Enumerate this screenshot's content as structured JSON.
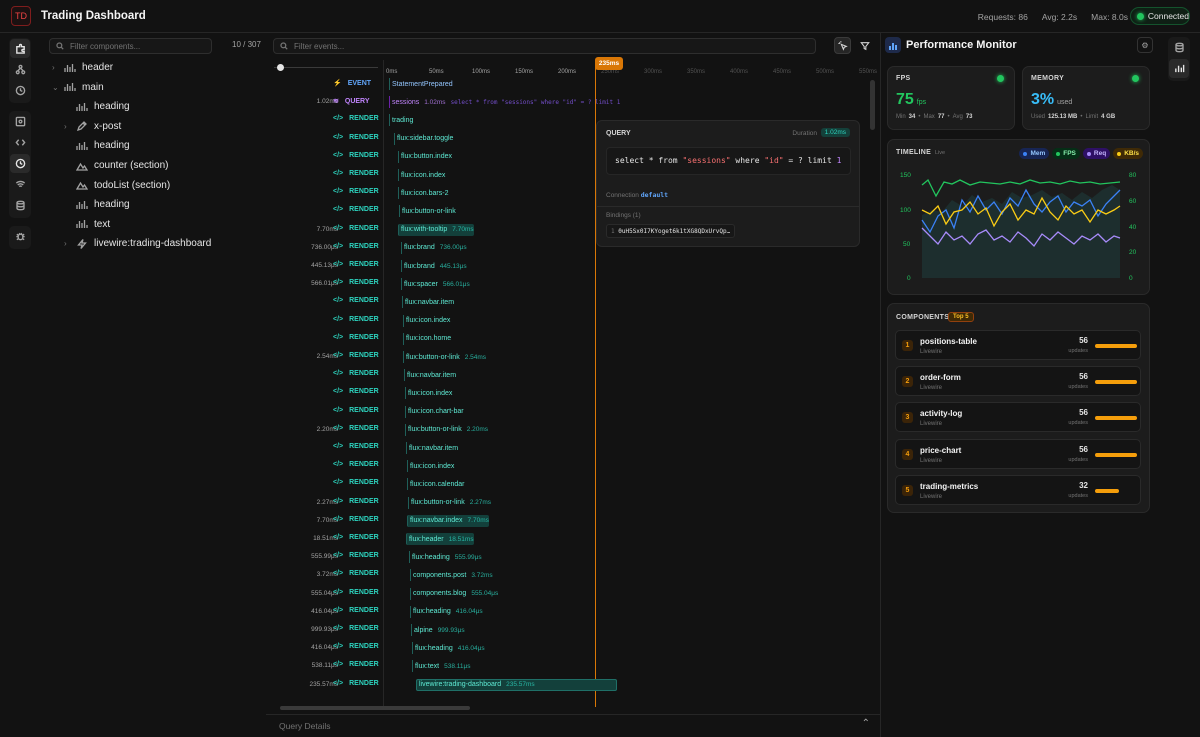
{
  "app": {
    "logo": "TD",
    "title": "Trading Dashboard"
  },
  "header_stats": {
    "requests": "Requests: 86",
    "avg": "Avg: 2.2s",
    "max": "Max: 8.0s",
    "connection": "Connected"
  },
  "tree": {
    "filter_placeholder": "Filter components...",
    "items": [
      {
        "label": "header",
        "icon": "bars-icon",
        "chev": "›"
      },
      {
        "label": "main",
        "icon": "bars-icon",
        "chev": "⌄"
      },
      {
        "label": "heading",
        "icon": "bars-icon",
        "chev": ""
      },
      {
        "label": "x-post",
        "icon": "pen-icon",
        "chev": "›"
      },
      {
        "label": "heading",
        "icon": "bars-icon",
        "chev": ""
      },
      {
        "label": "counter (section)",
        "icon": "mountain-icon",
        "chev": ""
      },
      {
        "label": "todoList (section)",
        "icon": "mountain-icon",
        "chev": ""
      },
      {
        "label": "heading",
        "icon": "bars-icon",
        "chev": ""
      },
      {
        "label": "text",
        "icon": "bars-icon",
        "chev": ""
      },
      {
        "label": "livewire:trading-dashboard",
        "icon": "bolt-icon",
        "chev": "›"
      }
    ]
  },
  "events": {
    "count": "10 / 307",
    "filter_placeholder": "Filter events...",
    "ticks": [
      "0ms",
      "50ms",
      "100ms",
      "150ms",
      "200ms",
      "250ms",
      "300ms",
      "350ms",
      "400ms",
      "450ms",
      "500ms",
      "550ms"
    ],
    "cursor_label": "235ms",
    "rows": [
      {
        "time": "",
        "kind": "EVENT",
        "label": "StatementPrepared",
        "dur": ""
      },
      {
        "time": "1.02ms",
        "kind": "QUERY",
        "label": "sessions",
        "dur": "1.02ms",
        "extra": "select * from \"sessions\" where \"id\" = ? limit 1"
      },
      {
        "time": "",
        "kind": "RENDER",
        "label": "trading",
        "dur": ""
      },
      {
        "time": "",
        "kind": "RENDER",
        "label": "flux:sidebar.toggle",
        "dur": ""
      },
      {
        "time": "",
        "kind": "RENDER",
        "label": "flux:button.index",
        "dur": ""
      },
      {
        "time": "",
        "kind": "RENDER",
        "label": "flux:icon.index",
        "dur": ""
      },
      {
        "time": "",
        "kind": "RENDER",
        "label": "flux:icon.bars-2",
        "dur": ""
      },
      {
        "time": "",
        "kind": "RENDER",
        "label": "flux:button-or-link",
        "dur": ""
      },
      {
        "time": "7.70ms",
        "kind": "RENDER",
        "label": "flux:with-tooltip",
        "dur": "7.70ms"
      },
      {
        "time": "736.00μs",
        "kind": "RENDER",
        "label": "flux:brand",
        "dur": "736.00μs"
      },
      {
        "time": "445.13μs",
        "kind": "RENDER",
        "label": "flux:brand",
        "dur": "445.13μs"
      },
      {
        "time": "566.01μs",
        "kind": "RENDER",
        "label": "flux:spacer",
        "dur": "566.01μs"
      },
      {
        "time": "",
        "kind": "RENDER",
        "label": "flux:navbar.item",
        "dur": ""
      },
      {
        "time": "",
        "kind": "RENDER",
        "label": "flux:icon.index",
        "dur": ""
      },
      {
        "time": "",
        "kind": "RENDER",
        "label": "flux:icon.home",
        "dur": ""
      },
      {
        "time": "2.54ms",
        "kind": "RENDER",
        "label": "flux:button-or-link",
        "dur": "2.54ms"
      },
      {
        "time": "",
        "kind": "RENDER",
        "label": "flux:navbar.item",
        "dur": ""
      },
      {
        "time": "",
        "kind": "RENDER",
        "label": "flux:icon.index",
        "dur": ""
      },
      {
        "time": "",
        "kind": "RENDER",
        "label": "flux:icon.chart-bar",
        "dur": ""
      },
      {
        "time": "2.20ms",
        "kind": "RENDER",
        "label": "flux:button-or-link",
        "dur": "2.20ms"
      },
      {
        "time": "",
        "kind": "RENDER",
        "label": "flux:navbar.item",
        "dur": ""
      },
      {
        "time": "",
        "kind": "RENDER",
        "label": "flux:icon.index",
        "dur": ""
      },
      {
        "time": "",
        "kind": "RENDER",
        "label": "flux:icon.calendar",
        "dur": ""
      },
      {
        "time": "2.27ms",
        "kind": "RENDER",
        "label": "flux:button-or-link",
        "dur": "2.27ms"
      },
      {
        "time": "7.70ms",
        "kind": "RENDER",
        "label": "flux:navbar.index",
        "dur": "7.70ms"
      },
      {
        "time": "18.51ms",
        "kind": "RENDER",
        "label": "flux:header",
        "dur": "18.51ms"
      },
      {
        "time": "555.99μs",
        "kind": "RENDER",
        "label": "flux:heading",
        "dur": "555.99μs"
      },
      {
        "time": "3.72ms",
        "kind": "RENDER",
        "label": "components.post",
        "dur": "3.72ms"
      },
      {
        "time": "555.04μs",
        "kind": "RENDER",
        "label": "components.blog",
        "dur": "555.04μs"
      },
      {
        "time": "416.04μs",
        "kind": "RENDER",
        "label": "flux:heading",
        "dur": "416.04μs"
      },
      {
        "time": "999.93μs",
        "kind": "RENDER",
        "label": "alpine",
        "dur": "999.93μs"
      },
      {
        "time": "416.04μs",
        "kind": "RENDER",
        "label": "flux:heading",
        "dur": "416.04μs"
      },
      {
        "time": "538.11μs",
        "kind": "RENDER",
        "label": "flux:text",
        "dur": "538.11μs"
      },
      {
        "time": "235.57ms",
        "kind": "RENDER",
        "label": "livewire:trading-dashboard",
        "dur": "235.57ms"
      }
    ]
  },
  "query_panel": {
    "title": "QUERY",
    "duration_label": "Duration",
    "duration": "1.02ms",
    "sql_kw1": "select * from ",
    "sql_tbl": "\"sessions\"",
    "sql_kw2": " where ",
    "sql_col": "\"id\"",
    "sql_kw3": " = ? limit ",
    "sql_num": "1",
    "connection_label": "Connection",
    "connection": "default",
    "bindings_label": "Bindings (1)",
    "binding_index": "1",
    "binding_value": "0uH5Sx0I7KYoget6k1tXG8QDxUrvQp…"
  },
  "bottom": {
    "label": "Query Details"
  },
  "perf": {
    "title": "Performance Monitor",
    "fps": {
      "label": "FPS",
      "value": "75",
      "unit": "fps",
      "min_label": "Min",
      "min": "34",
      "max_label": "Max",
      "max": "77",
      "avg_label": "Avg",
      "avg": "73"
    },
    "memory": {
      "label": "MEMORY",
      "value": "3%",
      "unit": "used",
      "used_label": "Used",
      "used": "125.13 MB",
      "limit_label": "Limit",
      "limit": "4 GB"
    },
    "timeline": {
      "label": "TIMELINE",
      "badge": "Live",
      "legend": [
        "Mem",
        "FPS",
        "Req",
        "KB/s"
      ],
      "left_ticks": [
        "150",
        "100",
        "50",
        "0"
      ],
      "right_ticks": [
        "80",
        "60",
        "40",
        "20",
        "0"
      ]
    },
    "components": {
      "label": "COMPONENTS",
      "badge": "Top 5",
      "updates_label": "updates",
      "items": [
        {
          "rank": "1",
          "name": "positions-table",
          "sub": "Livewire",
          "count": "56"
        },
        {
          "rank": "2",
          "name": "order-form",
          "sub": "Livewire",
          "count": "56"
        },
        {
          "rank": "3",
          "name": "activity-log",
          "sub": "Livewire",
          "count": "56"
        },
        {
          "rank": "4",
          "name": "price-chart",
          "sub": "Livewire",
          "count": "56"
        },
        {
          "rank": "5",
          "name": "trading-metrics",
          "sub": "Livewire",
          "count": "32"
        }
      ]
    }
  },
  "colors": {
    "mem": "#3b82f6",
    "fps": "#22c55e",
    "req": "#a78bfa",
    "kbs": "#facc15",
    "accent": "#2dd4bf",
    "cursor": "#d97706"
  }
}
